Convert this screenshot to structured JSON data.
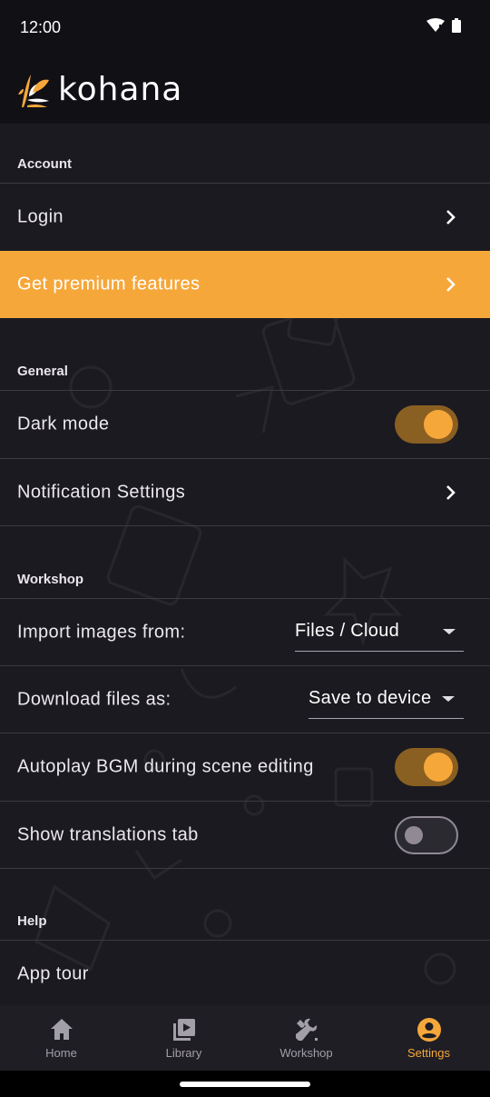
{
  "status_bar": {
    "time": "12:00"
  },
  "app": {
    "logo_text": "kohana"
  },
  "sections": {
    "account": {
      "title": "Account",
      "login_label": "Login",
      "premium_label": "Get premium features"
    },
    "general": {
      "title": "General",
      "dark_mode_label": "Dark mode",
      "dark_mode_on": true,
      "notification_label": "Notification Settings"
    },
    "workshop": {
      "title": "Workshop",
      "import_label": "Import images from:",
      "import_value": "Files / Cloud",
      "download_label": "Download files as:",
      "download_value": "Save to device",
      "autoplay_label": "Autoplay BGM during scene editing",
      "autoplay_on": true,
      "translations_label": "Show translations tab",
      "translations_on": false
    },
    "help": {
      "title": "Help",
      "app_tour_label": "App tour"
    }
  },
  "bottom_nav": {
    "items": [
      {
        "label": "Home",
        "icon": "home-icon",
        "active": false
      },
      {
        "label": "Library",
        "icon": "library-icon",
        "active": false
      },
      {
        "label": "Workshop",
        "icon": "wrench-icon",
        "active": false
      },
      {
        "label": "Settings",
        "icon": "account-circle-icon",
        "active": true
      }
    ]
  },
  "colors": {
    "accent": "#f6a73a",
    "background": "#1b1a20",
    "toggle_track_on": "#8a5f22",
    "nav_inactive": "#a39fa8"
  }
}
